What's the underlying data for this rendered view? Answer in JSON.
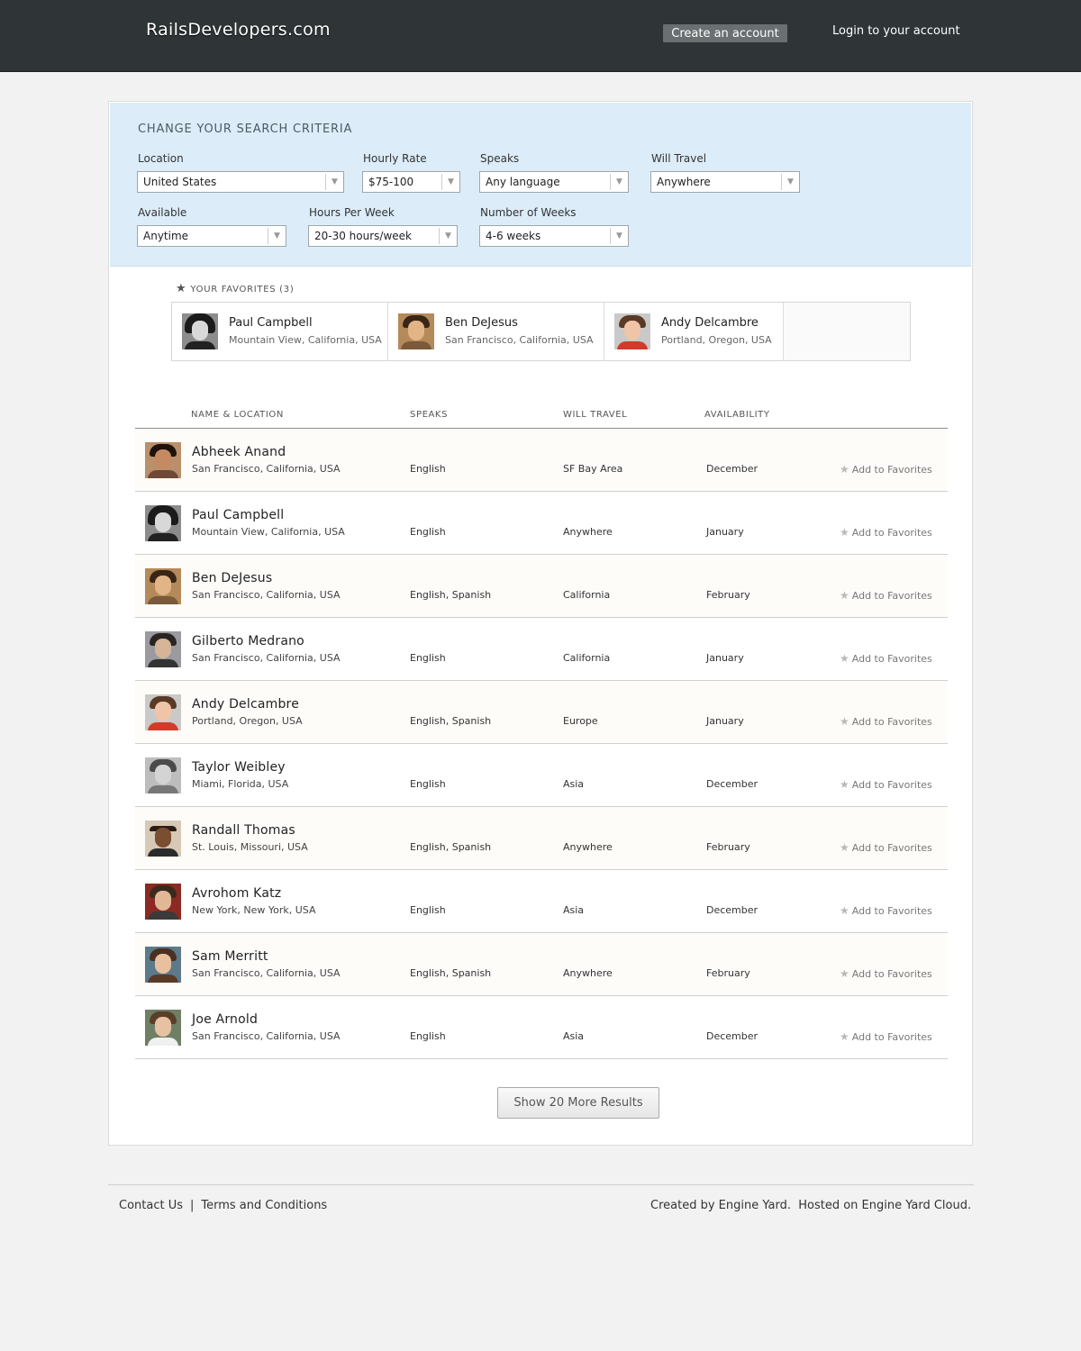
{
  "header": {
    "logo": "RailsDevelopers.com",
    "create_account": "Create an account",
    "login": "Login to your account"
  },
  "criteria": {
    "title": "CHANGE YOUR SEARCH CRITERIA",
    "location": {
      "label": "Location",
      "value": "United States"
    },
    "hourly_rate": {
      "label": "Hourly Rate",
      "value": "$75-100"
    },
    "speaks": {
      "label": "Speaks",
      "value": "Any language"
    },
    "will_travel": {
      "label": "Will Travel",
      "value": "Anywhere"
    },
    "available": {
      "label": "Available",
      "value": "Anytime"
    },
    "hours_per_week": {
      "label": "Hours Per Week",
      "value": "20-30 hours/week"
    },
    "number_of_weeks": {
      "label": "Number of Weeks",
      "value": "4-6 weeks"
    }
  },
  "favorites": {
    "title": "YOUR FAVORITES (3)",
    "items": [
      {
        "name": "Paul Campbell",
        "location": "Mountain View, California, USA"
      },
      {
        "name": "Ben DeJesus",
        "location": "San Francisco, California, USA"
      },
      {
        "name": "Andy Delcambre",
        "location": "Portland, Oregon, USA"
      }
    ]
  },
  "table": {
    "headers": {
      "name_location": "NAME & LOCATION",
      "speaks": "SPEAKS",
      "will_travel": "WILL TRAVEL",
      "availability": "AVAILABILITY"
    },
    "add_favorites_label": "Add to Favorites",
    "rows": [
      {
        "name": "Abheek Anand",
        "location": "San Francisco, California, USA",
        "speaks": "English",
        "travel": "SF Bay Area",
        "availability": "December"
      },
      {
        "name": "Paul Campbell",
        "location": "Mountain View, California, USA",
        "speaks": "English",
        "travel": "Anywhere",
        "availability": "January"
      },
      {
        "name": "Ben DeJesus",
        "location": "San Francisco, California, USA",
        "speaks": "English, Spanish",
        "travel": "California",
        "availability": "February"
      },
      {
        "name": "Gilberto Medrano",
        "location": "San Francisco, California, USA",
        "speaks": "English",
        "travel": "California",
        "availability": "January"
      },
      {
        "name": "Andy Delcambre",
        "location": "Portland, Oregon, USA",
        "speaks": "English, Spanish",
        "travel": "Europe",
        "availability": "January"
      },
      {
        "name": "Taylor Weibley",
        "location": "Miami, Florida, USA",
        "speaks": "English",
        "travel": "Asia",
        "availability": "December"
      },
      {
        "name": "Randall Thomas",
        "location": "St. Louis, Missouri, USA",
        "speaks": "English, Spanish",
        "travel": "Anywhere",
        "availability": "February"
      },
      {
        "name": "Avrohom Katz",
        "location": "New York, New York, USA",
        "speaks": "English",
        "travel": "Asia",
        "availability": "December"
      },
      {
        "name": "Sam Merritt",
        "location": "San Francisco, California, USA",
        "speaks": "English, Spanish",
        "travel": "Anywhere",
        "availability": "February"
      },
      {
        "name": "Joe Arnold",
        "location": "San Francisco, California, USA",
        "speaks": "English",
        "travel": "Asia",
        "availability": "December"
      }
    ],
    "more_button": "Show 20 More Results"
  },
  "footer": {
    "contact": "Contact Us",
    "separator": "|",
    "terms": "Terms and Conditions",
    "credit": "Created by Engine Yard.  Hosted on Engine Yard Cloud."
  }
}
